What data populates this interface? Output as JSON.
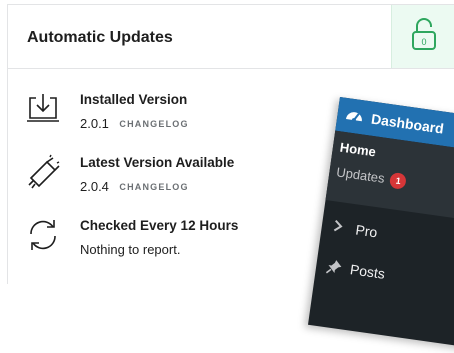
{
  "card": {
    "title": "Automatic Updates"
  },
  "rows": [
    {
      "icon": "download-icon",
      "title": "Installed Version",
      "version": "2.0.1",
      "link": "CHANGELOG"
    },
    {
      "icon": "megaphone-icon",
      "title": "Latest Version Available",
      "version": "2.0.4",
      "link": "CHANGELOG"
    },
    {
      "icon": "refresh-icon",
      "title": "Checked Every 12 Hours",
      "text": "Nothing to report."
    }
  ],
  "wp_menu": {
    "dashboard": "Dashboard",
    "home": "Home",
    "updates": "Updates",
    "updates_count": "1",
    "items": [
      "Pro",
      "Posts"
    ]
  },
  "colors": {
    "accent_green": "#2ea65e",
    "wp_blue": "#2271b1",
    "wp_dark": "#1d2327",
    "badge_red": "#d63638"
  }
}
